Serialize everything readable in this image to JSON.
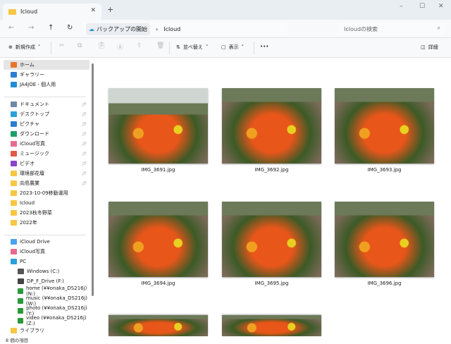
{
  "window": {
    "tab_title": "Icloud",
    "new_tab": "+",
    "minimize": "–",
    "maximize": "☐",
    "close": "✕"
  },
  "address": {
    "crumbs": [
      "バックアップの開始",
      "Icloud"
    ],
    "separator": "›",
    "search_placeholder": "Icloudの検索"
  },
  "toolbar": {
    "new": "新規作成",
    "sort": "並べ替え",
    "view": "表示",
    "more": "•••",
    "details": "詳細"
  },
  "sidebar": {
    "quick": [
      {
        "label": "ホーム",
        "color": "#e8742c"
      },
      {
        "label": "ギャラリー",
        "color": "#2f7dd1"
      },
      {
        "label": "JA4JOE - 個人用",
        "color": "#1f8fd6"
      }
    ],
    "pinned": [
      {
        "label": "ドキュメント",
        "color": "#6f87a8"
      },
      {
        "label": "デスクトップ",
        "color": "#2aa0d8"
      },
      {
        "label": "ピクチャ",
        "color": "#2f7dd1"
      },
      {
        "label": "ダウンロード",
        "color": "#1f9e6b"
      },
      {
        "label": "iCloud写真",
        "color": "#e66b8f"
      },
      {
        "label": "ミュージック",
        "color": "#e05a4a"
      },
      {
        "label": "ビデオ",
        "color": "#8a45c9"
      },
      {
        "label": "環境部花壇",
        "color": "#f6c744"
      },
      {
        "label": "向島農業",
        "color": "#f6c744"
      }
    ],
    "folders": [
      {
        "label": "2023-10-09移動運用",
        "color": "#f6c744"
      },
      {
        "label": "Icloud",
        "color": "#f6c744"
      },
      {
        "label": "2023秋冬野菜",
        "color": "#f6c744"
      },
      {
        "label": "2022年",
        "color": "#f6c744"
      }
    ],
    "drives": [
      {
        "label": "iCloud Drive",
        "color": "#4aa3f0"
      },
      {
        "label": "iCloud写真",
        "color": "#e66b8f"
      },
      {
        "label": "PC",
        "color": "#2aa0d8"
      },
      {
        "label": "Windows (C:)",
        "color": "#555"
      },
      {
        "label": "DP_F_Drive (F:)",
        "color": "#444"
      },
      {
        "label": "home (¥¥onaka_DS216j) (N:)",
        "color": "#2a9a3a"
      },
      {
        "label": "music (¥¥onaka_DS216j) (W:)",
        "color": "#2a9a3a"
      },
      {
        "label": "photo (¥¥onaka_DS216j) (Y:)",
        "color": "#2a9a3a"
      },
      {
        "label": "video (¥¥onaka_DS216j) (Z:)",
        "color": "#2a9a3a"
      },
      {
        "label": "ライブラリ",
        "color": "#f6c744"
      }
    ]
  },
  "files": [
    "IMG_3691.jpg",
    "IMG_3692.jpg",
    "IMG_3693.jpg",
    "IMG_3694.jpg",
    "IMG_3695.jpg",
    "IMG_3696.jpg",
    "",
    ""
  ],
  "status": "8 個の項目"
}
